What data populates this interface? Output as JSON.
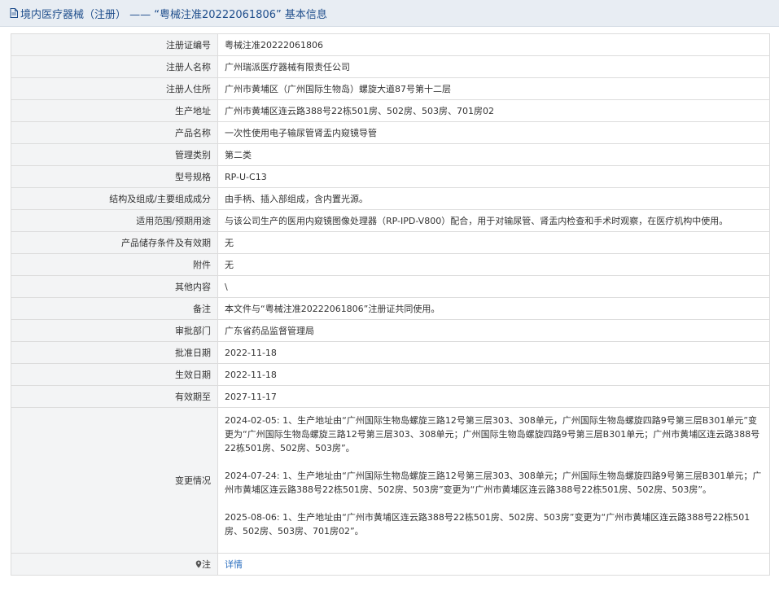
{
  "header": {
    "title": "境内医疗器械（注册） —— “粤械注准20222061806” 基本信息"
  },
  "rows": [
    {
      "label": "注册证编号",
      "value": "粤械注准20222061806"
    },
    {
      "label": "注册人名称",
      "value": "广州瑞派医疗器械有限责任公司"
    },
    {
      "label": "注册人住所",
      "value": "广州市黄埔区（广州国际生物岛）螺旋大道87号第十二层"
    },
    {
      "label": "生产地址",
      "value": "广州市黄埔区连云路388号22栋501房、502房、503房、701房02"
    },
    {
      "label": "产品名称",
      "value": "一次性使用电子输尿管肾盂内窥镜导管"
    },
    {
      "label": "管理类别",
      "value": "第二类"
    },
    {
      "label": "型号规格",
      "value": "RP-U-C13"
    },
    {
      "label": "结构及组成/主要组成成分",
      "value": "由手柄、插入部组成，含内置光源。"
    },
    {
      "label": "适用范围/预期用途",
      "value": "与该公司生产的医用内窥镜图像处理器（RP-IPD-V800）配合，用于对输尿管、肾盂内检查和手术时观察，在医疗机构中使用。"
    },
    {
      "label": "产品储存条件及有效期",
      "value": "无"
    },
    {
      "label": "附件",
      "value": "无"
    },
    {
      "label": "其他内容",
      "value": "\\"
    },
    {
      "label": "备注",
      "value": "本文件与“粤械注准20222061806”注册证共同使用。"
    },
    {
      "label": "审批部门",
      "value": "广东省药品监督管理局"
    },
    {
      "label": "批准日期",
      "value": "2022-11-18"
    },
    {
      "label": "生效日期",
      "value": "2022-11-18"
    },
    {
      "label": "有效期至",
      "value": "2027-11-17"
    }
  ],
  "changes": {
    "label": "变更情况",
    "entries": [
      "2024-02-05: 1、生产地址由“广州国际生物岛螺旋三路12号第三层303、308单元，广州国际生物岛螺旋四路9号第三层B301单元”变更为“广州国际生物岛螺旋三路12号第三层303、308单元；广州国际生物岛螺旋四路9号第三层B301单元；广州市黄埔区连云路388号22栋501房、502房、503房”。",
      "2024-07-24: 1、生产地址由“广州国际生物岛螺旋三路12号第三层303、308单元；广州国际生物岛螺旋四路9号第三层B301单元；广州市黄埔区连云路388号22栋501房、502房、503房”变更为“广州市黄埔区连云路388号22栋501房、502房、503房”。",
      "2025-08-06: 1、生产地址由“广州市黄埔区连云路388号22栋501房、502房、503房”变更为“广州市黄埔区连云路388号22栋501房、502房、503房、701房02”。"
    ]
  },
  "note": {
    "label": "注",
    "link": "详情"
  }
}
